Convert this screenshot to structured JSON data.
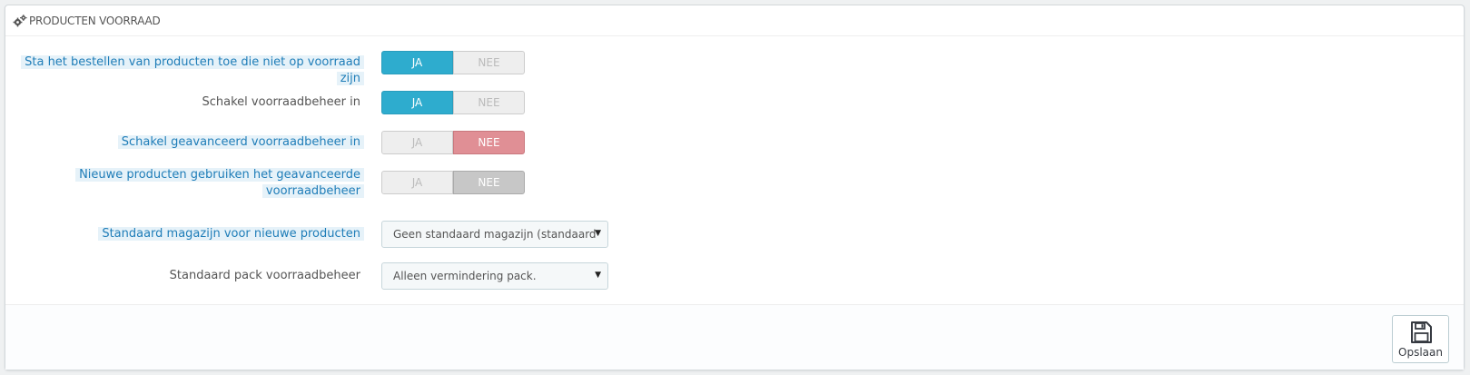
{
  "panel": {
    "title": "PRODUCTEN VOORRAAD",
    "icon": "gears-icon"
  },
  "fields": {
    "allow_oos_orders": {
      "label": "Sta het bestellen van producten toe die niet op voorraad zijn",
      "yes": "JA",
      "no": "NEE",
      "value": "JA"
    },
    "enable_stock_mgmt": {
      "label": "Schakel voorraadbeheer in",
      "yes": "JA",
      "no": "NEE",
      "value": "JA"
    },
    "advanced_stock_mgmt": {
      "label": "Schakel geavanceerd voorraadbeheer in",
      "yes": "JA",
      "no": "NEE",
      "value": "NEE"
    },
    "new_products_advanced": {
      "label_line1": "Nieuwe producten gebruiken het geavanceerde",
      "label_line2": "voorraadbeheer",
      "yes": "JA",
      "no": "NEE",
      "value": "NEE",
      "disabled": true
    },
    "default_warehouse": {
      "label": "Standaard magazijn voor nieuwe producten",
      "selected": "Geen standaard magazijn (standaard"
    },
    "default_pack_stock": {
      "label": "Standaard pack voorraadbeheer",
      "selected": "Alleen vermindering pack."
    }
  },
  "footer": {
    "save_label": "Opslaan",
    "save_icon": "floppy-disk-icon"
  },
  "colors": {
    "accent_yes": "#2eacce",
    "accent_no": "#e08f95",
    "hint_bg": "#e6f2f9",
    "hint_text": "#1f7db8"
  }
}
